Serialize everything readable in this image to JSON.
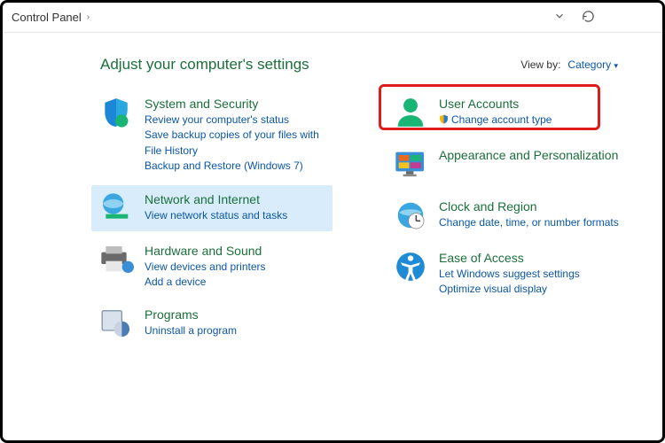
{
  "breadcrumb": {
    "root": "Control Panel"
  },
  "heading": "Adjust your computer's settings",
  "viewby": {
    "label": "View by:",
    "value": "Category"
  },
  "left": [
    {
      "title": "System and Security",
      "links": [
        "Review your computer's status",
        "Save backup copies of your files with File History",
        "Backup and Restore (Windows 7)"
      ]
    },
    {
      "title": "Network and Internet",
      "links": [
        "View network status and tasks"
      ]
    },
    {
      "title": "Hardware and Sound",
      "links": [
        "View devices and printers",
        "Add a device"
      ]
    },
    {
      "title": "Programs",
      "links": [
        "Uninstall a program"
      ]
    }
  ],
  "right": [
    {
      "title": "User Accounts",
      "links": [
        "Change account type"
      ],
      "shield": true
    },
    {
      "title": "Appearance and Personalization",
      "links": []
    },
    {
      "title": "Clock and Region",
      "links": [
        "Change date, time, or number formats"
      ]
    },
    {
      "title": "Ease of Access",
      "links": [
        "Let Windows suggest settings",
        "Optimize visual display"
      ]
    }
  ]
}
